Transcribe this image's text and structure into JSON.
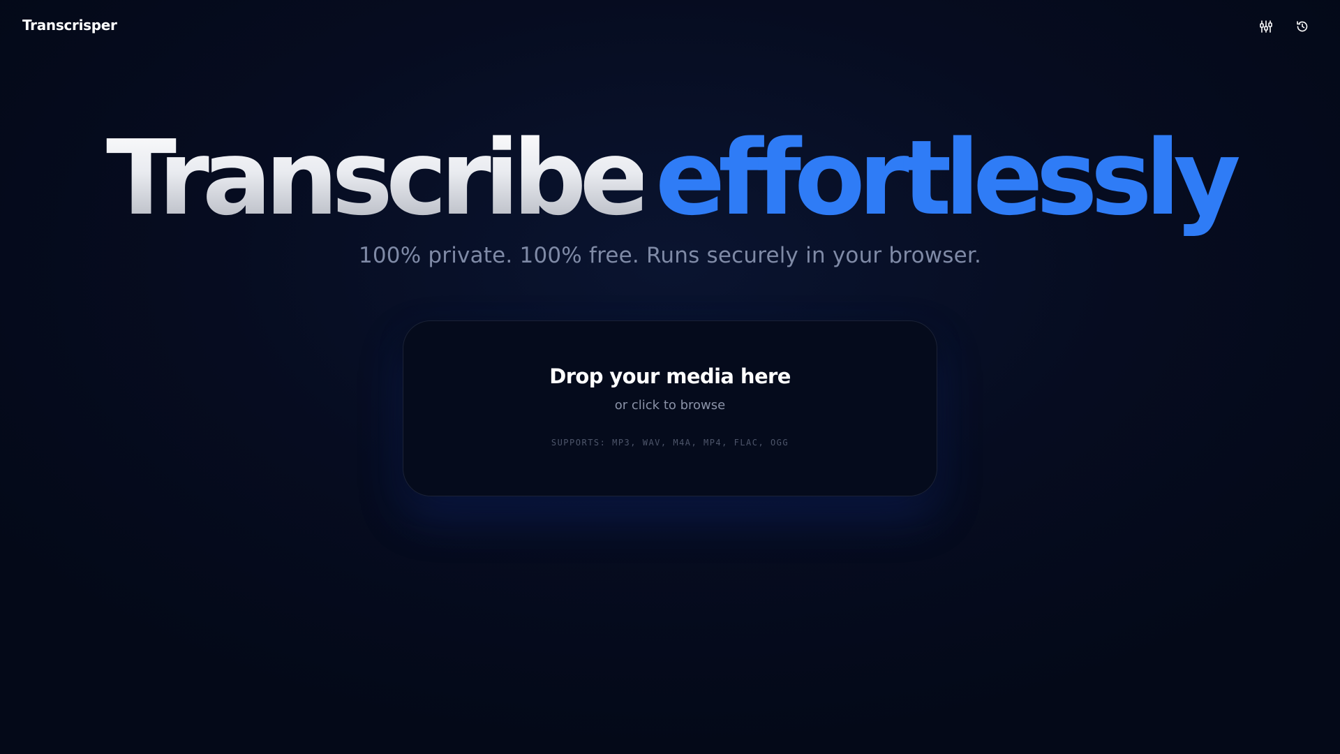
{
  "app": {
    "brand": "Transcrisper"
  },
  "header": {
    "icons": [
      "sliders-icon",
      "history-icon"
    ]
  },
  "hero": {
    "title_part1": "Transcribe",
    "title_part2": "effortlessly",
    "subtitle": "100% private. 100% free. Runs securely in your browser."
  },
  "dropzone": {
    "title": "Drop your media here",
    "subtitle": "or click to browse",
    "supports": "SUPPORTS: MP3, WAV, M4A, MP4, FLAC, OGG"
  },
  "colors": {
    "background": "#050b1c",
    "accent": "#2f7cf6",
    "muted_text": "#7f8aa6"
  }
}
